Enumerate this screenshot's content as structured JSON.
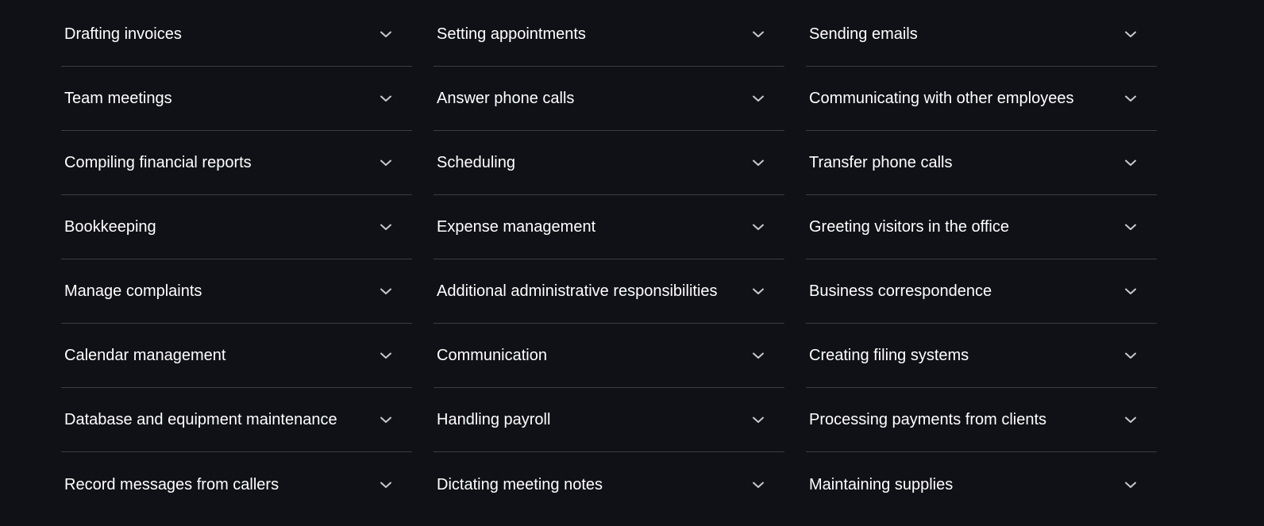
{
  "theme": {
    "background": "#101116",
    "text": "#ffffff",
    "divider": "#3a3c44",
    "icon": "#c8c9cc"
  },
  "accordion": {
    "columns": [
      {
        "items": [
          {
            "label": "Drafting invoices",
            "icon": "chevron-down-icon"
          },
          {
            "label": "Team meetings",
            "icon": "chevron-down-icon"
          },
          {
            "label": "Compiling financial reports",
            "icon": "chevron-down-icon"
          },
          {
            "label": "Bookkeeping",
            "icon": "chevron-down-icon"
          },
          {
            "label": "Manage complaints",
            "icon": "chevron-down-icon"
          },
          {
            "label": "Calendar management",
            "icon": "chevron-down-icon"
          },
          {
            "label": "Database and equipment maintenance",
            "icon": "chevron-down-icon"
          },
          {
            "label": "Record messages from callers",
            "icon": "chevron-down-icon"
          }
        ]
      },
      {
        "items": [
          {
            "label": "Setting appointments",
            "icon": "chevron-down-icon"
          },
          {
            "label": "Answer phone calls",
            "icon": "chevron-down-icon"
          },
          {
            "label": "Scheduling",
            "icon": "chevron-down-icon"
          },
          {
            "label": "Expense management",
            "icon": "chevron-down-icon"
          },
          {
            "label": "Additional administrative responsibilities",
            "icon": "chevron-down-icon"
          },
          {
            "label": "Communication",
            "icon": "chevron-down-icon"
          },
          {
            "label": "Handling payroll",
            "icon": "chevron-down-icon"
          },
          {
            "label": "Dictating meeting notes",
            "icon": "chevron-down-icon"
          }
        ]
      },
      {
        "items": [
          {
            "label": "Sending emails",
            "icon": "chevron-down-icon"
          },
          {
            "label": "Communicating with other employees",
            "icon": "chevron-down-icon"
          },
          {
            "label": "Transfer phone calls",
            "icon": "chevron-down-icon"
          },
          {
            "label": "Greeting visitors in the office",
            "icon": "chevron-down-icon"
          },
          {
            "label": "Business correspondence",
            "icon": "chevron-down-icon"
          },
          {
            "label": "Creating filing systems",
            "icon": "chevron-down-icon"
          },
          {
            "label": "Processing payments from clients",
            "icon": "chevron-down-icon"
          },
          {
            "label": "Maintaining supplies",
            "icon": "chevron-down-icon"
          }
        ]
      }
    ]
  }
}
